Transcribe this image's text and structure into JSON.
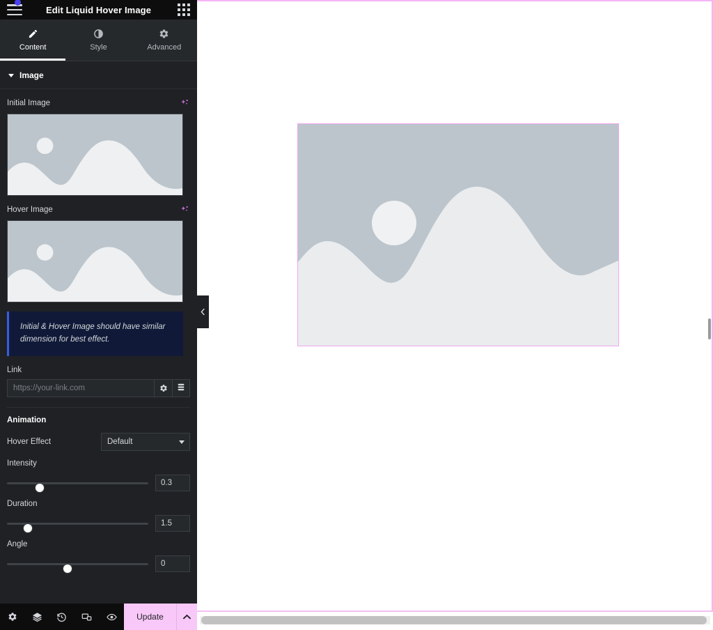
{
  "panel": {
    "header": {
      "title": "Edit Liquid Hover Image",
      "menu_icon": "hamburger-menu-icon",
      "apps_icon": "apps-grid-icon",
      "notification_dot": true
    },
    "tabs": [
      {
        "label": "Content",
        "icon": "pencil-icon",
        "active": true
      },
      {
        "label": "Style",
        "icon": "contrast-icon",
        "active": false
      },
      {
        "label": "Advanced",
        "icon": "gear-icon",
        "active": false
      }
    ],
    "sections": {
      "image": {
        "title": "Image",
        "expanded": true,
        "initial_image": {
          "label": "Initial Image",
          "ai_icon": "ai-sparkle-icon"
        },
        "hover_image": {
          "label": "Hover Image",
          "ai_icon": "ai-sparkle-icon"
        },
        "notice": "Initial & Hover Image should have similar dimension for best effect.",
        "link": {
          "label": "Link",
          "value": "",
          "placeholder": "https://your-link.com",
          "options_icon": "gear-icon",
          "dynamic_icon": "dynamic-tags-icon"
        }
      },
      "animation": {
        "title": "Animation",
        "hover_effect": {
          "label": "Hover Effect",
          "selected": "Default",
          "options": [
            "Default"
          ]
        },
        "sliders": [
          {
            "label": "Intensity",
            "value": "0.3",
            "percent": 23
          },
          {
            "label": "Duration",
            "value": "1.5",
            "percent": 15
          },
          {
            "label": "Angle",
            "value": "0",
            "percent": 43
          }
        ]
      }
    },
    "footer": {
      "icons": [
        {
          "name": "settings-icon"
        },
        {
          "name": "navigator-layers-icon"
        },
        {
          "name": "history-icon"
        },
        {
          "name": "responsive-mode-icon"
        },
        {
          "name": "preview-eye-icon"
        }
      ],
      "update_label": "Update",
      "update_caret_icon": "chevron-up-icon"
    }
  },
  "canvas": {
    "collapse_handle_icon": "chevron-left-icon",
    "widget": {
      "name": "liquid-hover-image-widget",
      "placeholder_alt": "image placeholder"
    },
    "accent_color": "#f5b5f5",
    "selection_color": "#f0a8f0"
  }
}
